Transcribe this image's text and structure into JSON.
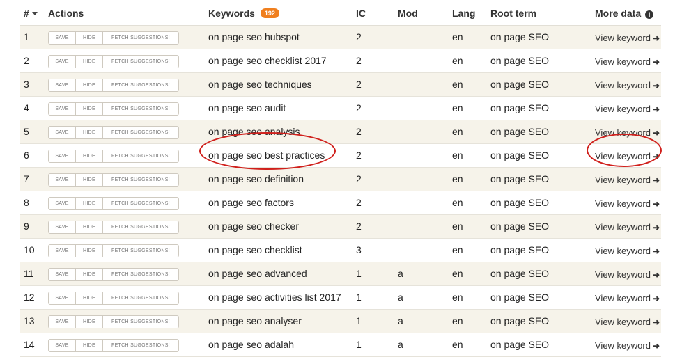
{
  "header": {
    "num": "#",
    "actions": "Actions",
    "keywords": "Keywords",
    "keyword_count": "192",
    "ic": "IC",
    "mod": "Mod",
    "lang": "Lang",
    "root_term": "Root term",
    "more_data": "More data"
  },
  "actions": {
    "save": "SAVE",
    "hide": "HIDE",
    "fetch": "FETCH SUGGESTIONS!"
  },
  "view_label": "View keyword",
  "rows": [
    {
      "num": "1",
      "keyword": "on page seo hubspot",
      "ic": "2",
      "mod": "",
      "lang": "en",
      "root": "on page SEO"
    },
    {
      "num": "2",
      "keyword": "on page seo checklist 2017",
      "ic": "2",
      "mod": "",
      "lang": "en",
      "root": "on page SEO"
    },
    {
      "num": "3",
      "keyword": "on page seo techniques",
      "ic": "2",
      "mod": "",
      "lang": "en",
      "root": "on page SEO"
    },
    {
      "num": "4",
      "keyword": "on page seo audit",
      "ic": "2",
      "mod": "",
      "lang": "en",
      "root": "on page SEO"
    },
    {
      "num": "5",
      "keyword": "on page seo analysis",
      "ic": "2",
      "mod": "",
      "lang": "en",
      "root": "on page SEO"
    },
    {
      "num": "6",
      "keyword": "on page seo best practices",
      "ic": "2",
      "mod": "",
      "lang": "en",
      "root": "on page SEO"
    },
    {
      "num": "7",
      "keyword": "on page seo definition",
      "ic": "2",
      "mod": "",
      "lang": "en",
      "root": "on page SEO"
    },
    {
      "num": "8",
      "keyword": "on page seo factors",
      "ic": "2",
      "mod": "",
      "lang": "en",
      "root": "on page SEO"
    },
    {
      "num": "9",
      "keyword": "on page seo checker",
      "ic": "2",
      "mod": "",
      "lang": "en",
      "root": "on page SEO"
    },
    {
      "num": "10",
      "keyword": "on page seo checklist",
      "ic": "3",
      "mod": "",
      "lang": "en",
      "root": "on page SEO"
    },
    {
      "num": "11",
      "keyword": "on page seo advanced",
      "ic": "1",
      "mod": "a",
      "lang": "en",
      "root": "on page SEO"
    },
    {
      "num": "12",
      "keyword": "on page seo activities list 2017",
      "ic": "1",
      "mod": "a",
      "lang": "en",
      "root": "on page SEO"
    },
    {
      "num": "13",
      "keyword": "on page seo analyser",
      "ic": "1",
      "mod": "a",
      "lang": "en",
      "root": "on page SEO"
    },
    {
      "num": "14",
      "keyword": "on page seo adalah",
      "ic": "1",
      "mod": "a",
      "lang": "en",
      "root": "on page SEO"
    }
  ],
  "colors": {
    "badge": "#f07f1e",
    "stripe": "#f6f3ea",
    "annotation": "#d0201c"
  },
  "icons": {
    "sort": "caret-down-icon",
    "info": "info-circle-icon",
    "arrow": "arrow-right-icon"
  }
}
